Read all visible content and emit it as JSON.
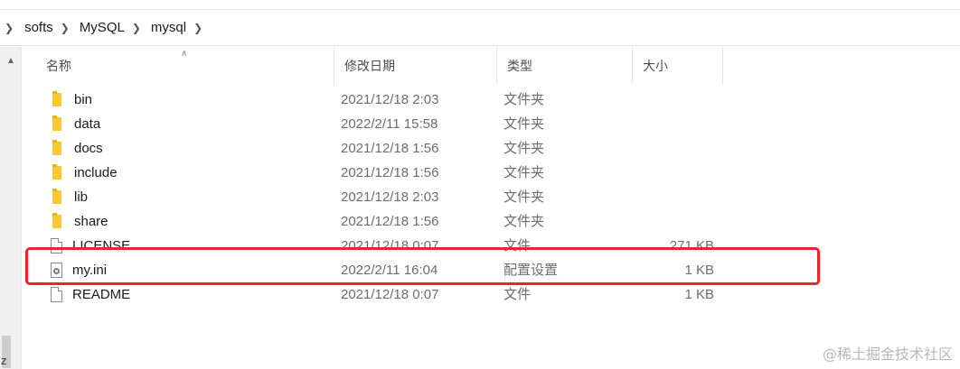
{
  "breadcrumb": [
    "softs",
    "MySQL",
    "mysql"
  ],
  "columns": {
    "name": "名称",
    "modified": "修改日期",
    "type": "类型",
    "size": "大小"
  },
  "files": [
    {
      "name": "bin",
      "modified": "2021/12/18 2:03",
      "type": "文件夹",
      "size": "",
      "icon": "folder-icon"
    },
    {
      "name": "data",
      "modified": "2022/2/11 15:58",
      "type": "文件夹",
      "size": "",
      "icon": "folder-icon"
    },
    {
      "name": "docs",
      "modified": "2021/12/18 1:56",
      "type": "文件夹",
      "size": "",
      "icon": "folder-icon"
    },
    {
      "name": "include",
      "modified": "2021/12/18 1:56",
      "type": "文件夹",
      "size": "",
      "icon": "folder-icon"
    },
    {
      "name": "lib",
      "modified": "2021/12/18 2:03",
      "type": "文件夹",
      "size": "",
      "icon": "folder-icon"
    },
    {
      "name": "share",
      "modified": "2021/12/18 1:56",
      "type": "文件夹",
      "size": "",
      "icon": "folder-icon"
    },
    {
      "name": "LICENSE",
      "modified": "2021/12/18 0:07",
      "type": "文件",
      "size": "271 KB",
      "icon": "file-icon"
    },
    {
      "name": "my.ini",
      "modified": "2022/2/11 16:04",
      "type": "配置设置",
      "size": "1 KB",
      "icon": "ini-settings-icon"
    },
    {
      "name": "README",
      "modified": "2021/12/18 0:07",
      "type": "文件",
      "size": "1 KB",
      "icon": "file-icon"
    }
  ],
  "highlight_color": "#e8262b",
  "scrollbar_edge_char": "z",
  "watermark": "@稀土掘金技术社区"
}
